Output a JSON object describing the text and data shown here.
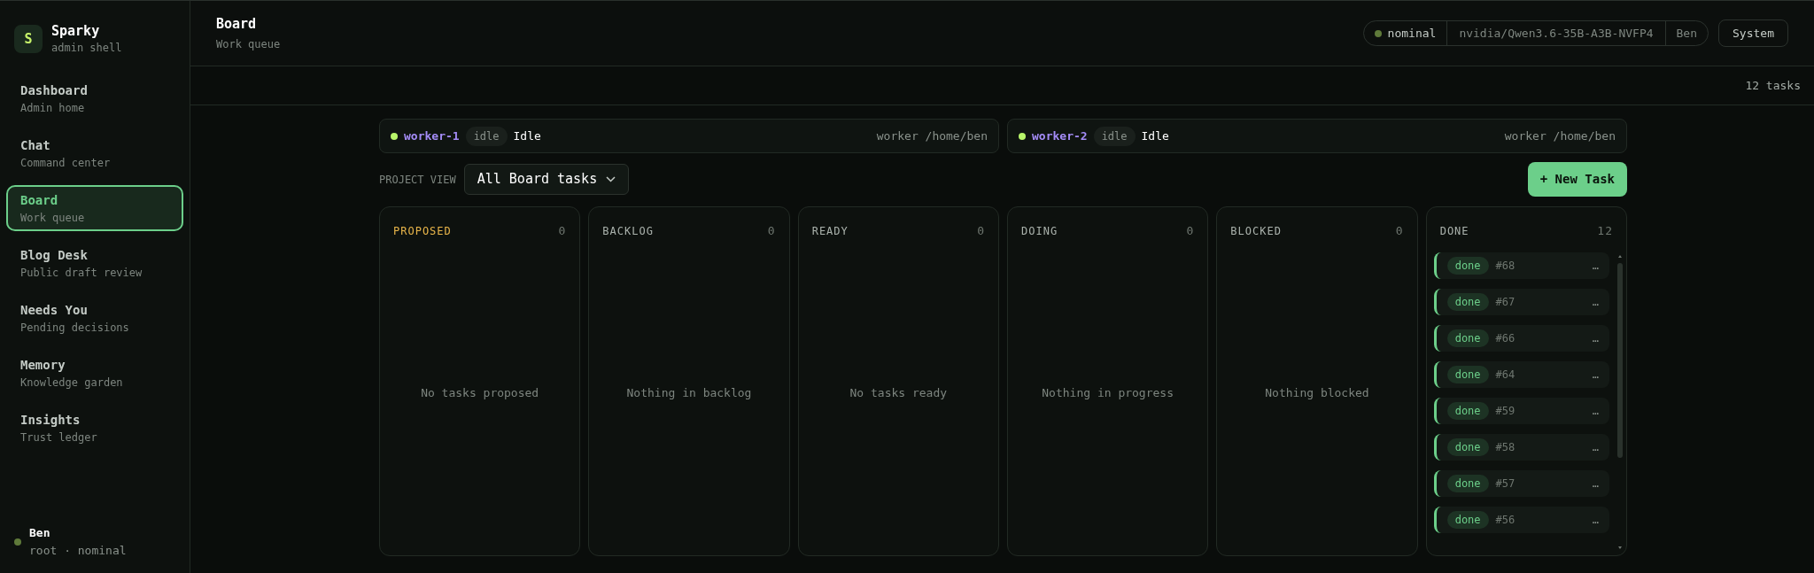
{
  "brand": {
    "logo": "S",
    "name": "Sparky",
    "subtitle": "admin shell"
  },
  "nav": [
    {
      "label": "Dashboard",
      "sub": "Admin home",
      "selected": false
    },
    {
      "label": "Chat",
      "sub": "Command center",
      "selected": false
    },
    {
      "label": "Board",
      "sub": "Work queue",
      "selected": true
    },
    {
      "label": "Blog Desk",
      "sub": "Public draft review",
      "selected": false
    },
    {
      "label": "Needs You",
      "sub": "Pending decisions",
      "selected": false
    },
    {
      "label": "Memory",
      "sub": "Knowledge garden",
      "selected": false
    },
    {
      "label": "Insights",
      "sub": "Trust ledger",
      "selected": false
    }
  ],
  "user": {
    "name": "Ben",
    "detail": "root · nominal",
    "color": "#5f7a3a"
  },
  "header": {
    "title": "Board",
    "subtitle": "Work queue",
    "status": {
      "label": "nominal",
      "color": "#5f7a3a"
    },
    "model": "nvidia/Qwen3.6-35B-A3B-NVFP4",
    "user": "Ben",
    "button": "System"
  },
  "task_count": "12 tasks",
  "workers": [
    {
      "name": "worker-1",
      "badge": "idle",
      "state": "Idle",
      "path": "worker /home/ben",
      "color": "#b8f56a"
    },
    {
      "name": "worker-2",
      "badge": "idle",
      "state": "Idle",
      "path": "worker /home/ben",
      "color": "#b8f56a"
    }
  ],
  "project_view": {
    "label": "PROJECT VIEW",
    "value": "All Board tasks"
  },
  "new_task": "+ New Task",
  "columns": [
    {
      "title": "PROPOSED",
      "count": "0",
      "empty": "No tasks proposed",
      "highlight": true
    },
    {
      "title": "BACKLOG",
      "count": "0",
      "empty": "Nothing in backlog",
      "highlight": false
    },
    {
      "title": "READY",
      "count": "0",
      "empty": "No tasks ready",
      "highlight": false
    },
    {
      "title": "DOING",
      "count": "0",
      "empty": "Nothing in progress",
      "highlight": false
    },
    {
      "title": "BLOCKED",
      "count": "0",
      "empty": "Nothing blocked",
      "highlight": false
    },
    {
      "title": "DONE",
      "count": "12",
      "highlight": false,
      "cards": [
        {
          "status": "done",
          "id": "#68",
          "menu": "…"
        },
        {
          "status": "done",
          "id": "#67",
          "menu": "…"
        },
        {
          "status": "done",
          "id": "#66",
          "menu": "…"
        },
        {
          "status": "done",
          "id": "#64",
          "menu": "…"
        },
        {
          "status": "done",
          "id": "#59",
          "menu": "…"
        },
        {
          "status": "done",
          "id": "#58",
          "menu": "…"
        },
        {
          "status": "done",
          "id": "#57",
          "menu": "…"
        },
        {
          "status": "done",
          "id": "#56",
          "menu": "…"
        }
      ]
    }
  ]
}
